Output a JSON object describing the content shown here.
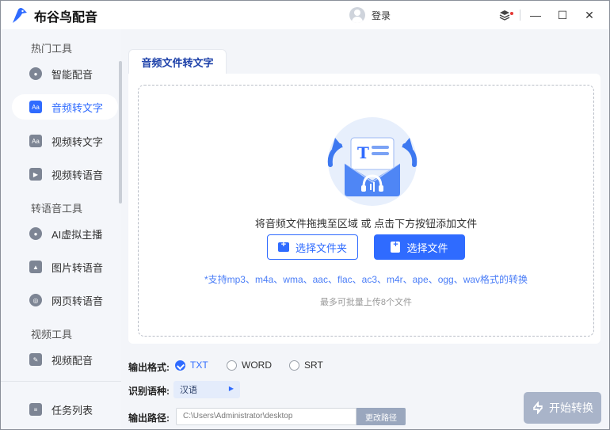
{
  "app": {
    "title": "布谷鸟配音",
    "brand_color": "#2f6bff"
  },
  "header": {
    "login_label": "登录"
  },
  "window_controls": {
    "layers_icon": "layers-icon",
    "minimize": "—",
    "maximize": "☐",
    "close": "✕"
  },
  "sidebar": {
    "sections": [
      {
        "title": "热门工具"
      },
      {
        "title": "转语音工具"
      },
      {
        "title": "视频工具"
      }
    ],
    "items": [
      {
        "label": "智能配音",
        "icon": "mic-icon",
        "active": false
      },
      {
        "label": "音频转文字",
        "icon": "audio-text-icon",
        "active": true
      },
      {
        "label": "视频转文字",
        "icon": "video-text-icon",
        "active": false
      },
      {
        "label": "视频转语音",
        "icon": "video-voice-icon",
        "active": false
      },
      {
        "label": "AI虚拟主播",
        "icon": "avatar-icon",
        "active": false
      },
      {
        "label": "图片转语音",
        "icon": "image-icon",
        "active": false
      },
      {
        "label": "网页转语音",
        "icon": "globe-icon",
        "active": false
      },
      {
        "label": "视频配音",
        "icon": "video-dub-icon",
        "active": false
      }
    ],
    "task_list": {
      "label": "任务列表",
      "icon": "list-icon"
    }
  },
  "main": {
    "tab_label": "音频文件转文字",
    "drop_hint": "将音频文件拖拽至区域 或 点击下方按钮添加文件",
    "select_folder_label": "选择文件夹",
    "select_file_label": "选择文件",
    "supported_formats": "*支持mp3、m4a、wma、aac、flac、ac3、m4r、ape、ogg、wav格式的转换",
    "limit_text": "最多可批量上传8个文件"
  },
  "options": {
    "format_label": "输出格式:",
    "formats": [
      {
        "label": "TXT",
        "checked": true
      },
      {
        "label": "WORD",
        "checked": false
      },
      {
        "label": "SRT",
        "checked": false
      }
    ],
    "language_label": "识别语种:",
    "language_value": "汉语",
    "path_label": "输出路径:",
    "path_value": "C:\\Users\\Administrator\\desktop",
    "change_path_label": "更改路径"
  },
  "start_button": {
    "label": "开始转换"
  }
}
